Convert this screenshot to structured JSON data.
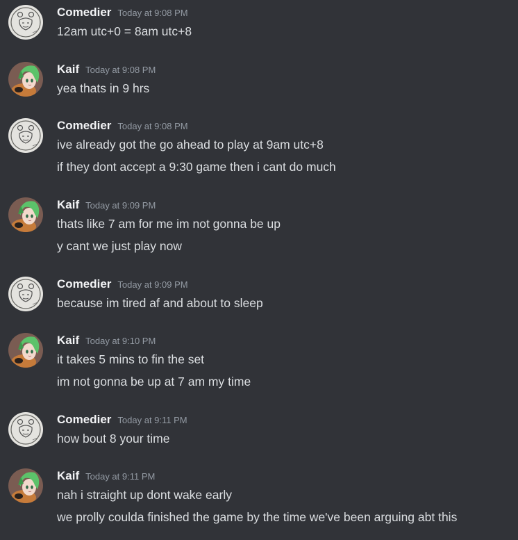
{
  "messages": [
    {
      "author": "Comedier",
      "avatar_icon": "sketch-face-avatar",
      "timestamp": "Today at 9:08 PM",
      "lines": [
        "12am utc+0 = 8am utc+8"
      ]
    },
    {
      "author": "Kaif",
      "avatar_icon": "anime-green-hair-avatar",
      "timestamp": "Today at 9:08 PM",
      "lines": [
        "yea thats in 9 hrs"
      ]
    },
    {
      "author": "Comedier",
      "avatar_icon": "sketch-face-avatar",
      "timestamp": "Today at 9:08 PM",
      "lines": [
        "ive already got the go ahead to play at 9am utc+8",
        "if they dont accept a 9:30 game then i cant do much"
      ]
    },
    {
      "author": "Kaif",
      "avatar_icon": "anime-green-hair-avatar",
      "timestamp": "Today at 9:09 PM",
      "lines": [
        "thats like 7 am for me im not gonna be up",
        "y cant we just play now"
      ]
    },
    {
      "author": "Comedier",
      "avatar_icon": "sketch-face-avatar",
      "timestamp": "Today at 9:09 PM",
      "lines": [
        "because im tired af and about to sleep"
      ]
    },
    {
      "author": "Kaif",
      "avatar_icon": "anime-green-hair-avatar",
      "timestamp": "Today at 9:10 PM",
      "lines": [
        "it takes 5 mins to fin the set",
        "im not gonna be up at 7 am my time"
      ]
    },
    {
      "author": "Comedier",
      "avatar_icon": "sketch-face-avatar",
      "timestamp": "Today at 9:11 PM",
      "lines": [
        "how bout 8 your time"
      ]
    },
    {
      "author": "Kaif",
      "avatar_icon": "anime-green-hair-avatar",
      "timestamp": "Today at 9:11 PM",
      "lines": [
        "nah i straight up dont wake early",
        "we prolly coulda finished the game by the time we've been arguing abt this"
      ]
    }
  ],
  "colors": {
    "background": "#313338",
    "username": "#f2f3f5",
    "timestamp": "#949ba4",
    "text": "#dbdee1"
  }
}
